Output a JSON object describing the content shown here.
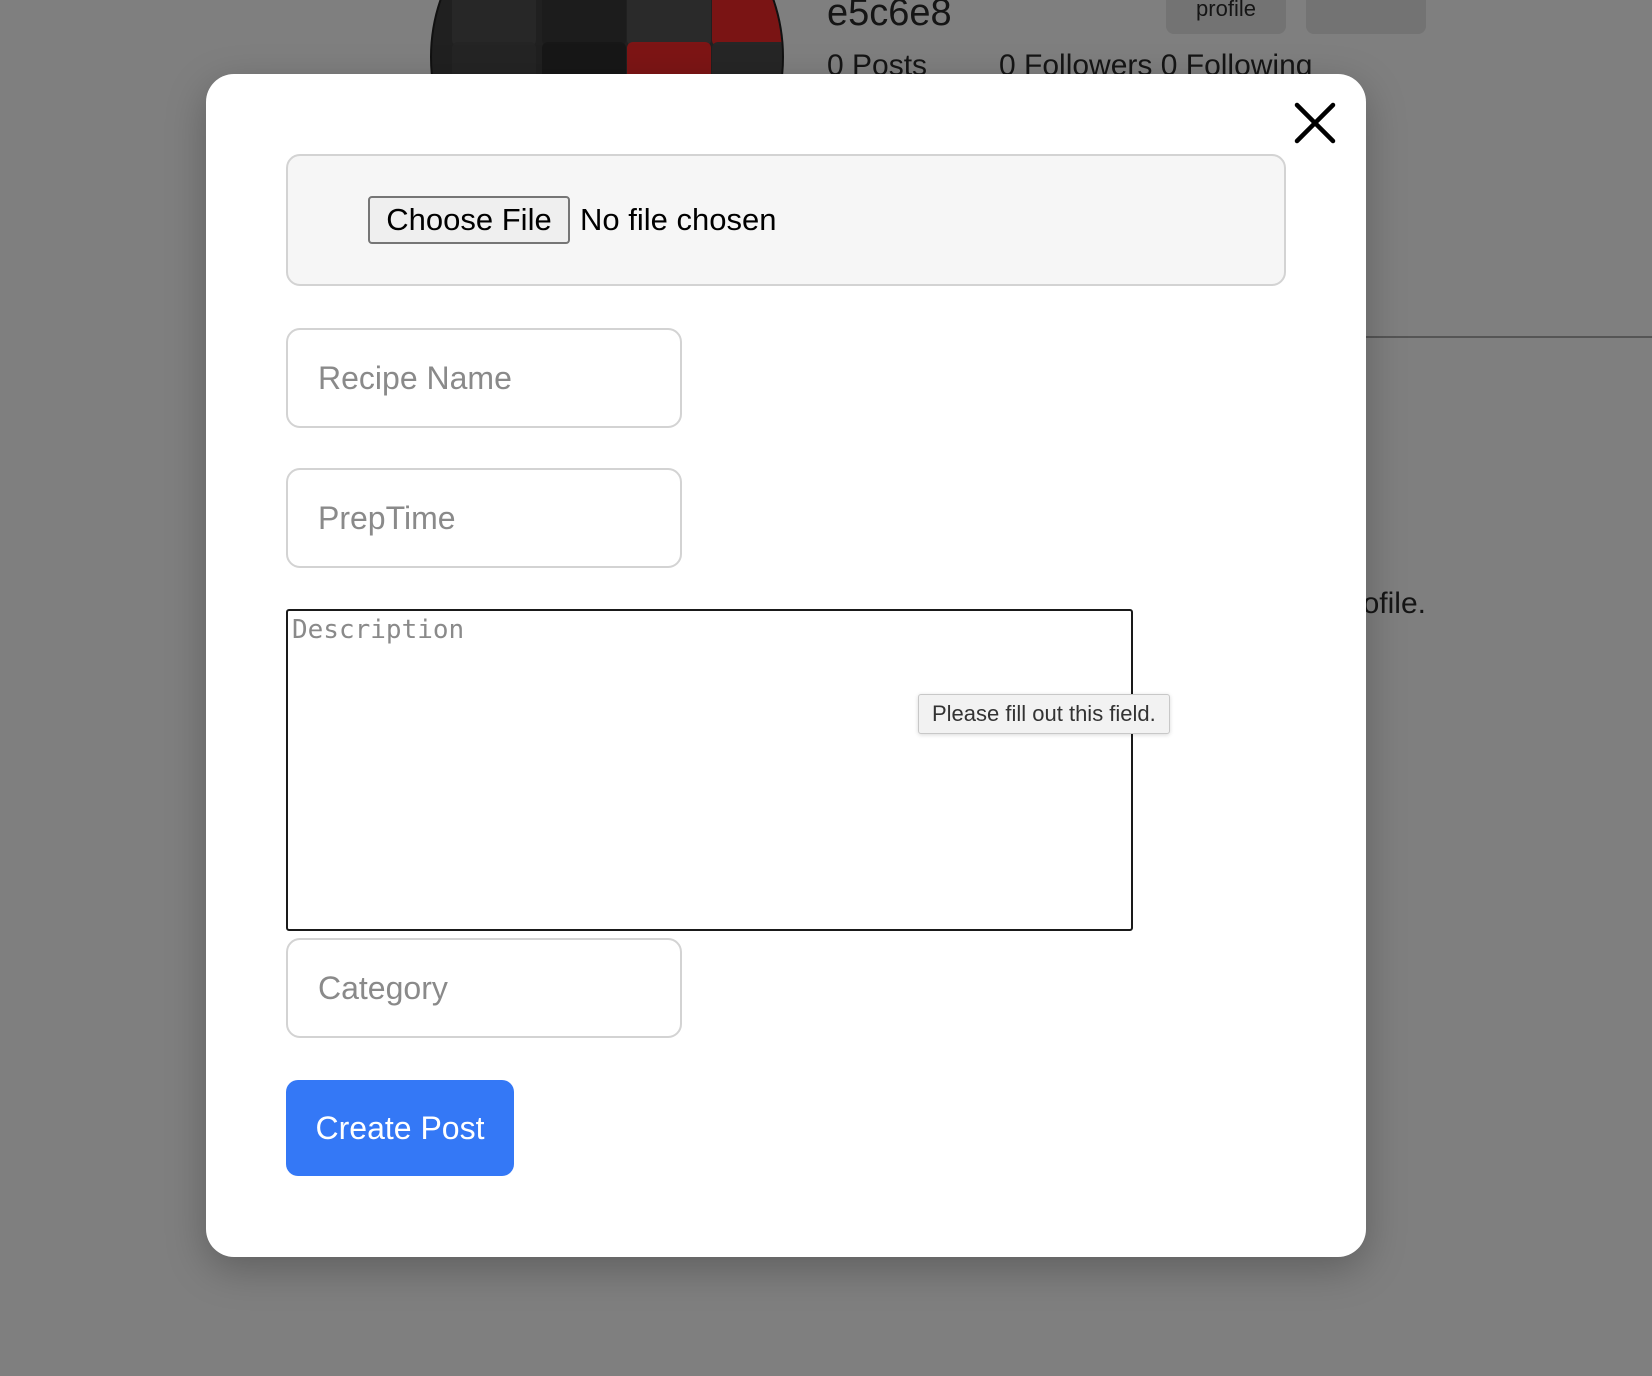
{
  "background_page": {
    "username": "e5c6e8",
    "posts_text": "0 Posts",
    "followers_following_text": "0 Followers 0 Following",
    "profile_button_label": "profile",
    "second_button_label": "",
    "message_fragment": "ofile."
  },
  "modal": {
    "close_icon": "close-icon",
    "file_upload": {
      "button_label": "Choose File",
      "status_text": "No file chosen"
    },
    "fields": {
      "recipe_name_placeholder": "Recipe Name",
      "prep_time_placeholder": "PrepTime",
      "description_placeholder": "Description",
      "category_placeholder": "Category"
    },
    "validation_tooltip": "Please fill out this field.",
    "submit_label": "Create Post"
  },
  "colors": {
    "overlay": "#7f7f7f",
    "modal_background": "#ffffff",
    "primary_button": "#3478f6",
    "primary_button_text": "#ffffff",
    "input_border": "#d3d3d3",
    "placeholder_text": "#8a8a8a"
  }
}
